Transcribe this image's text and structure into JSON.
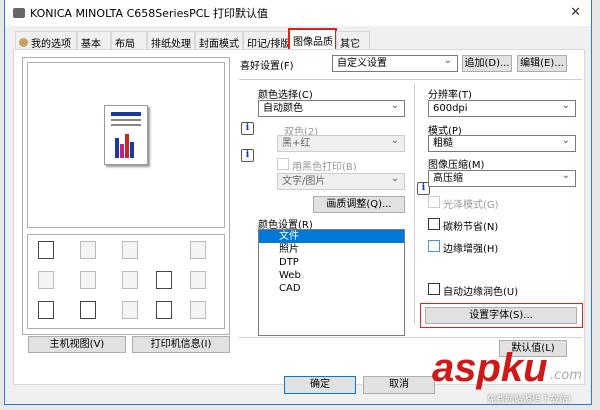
{
  "window": {
    "title": "KONICA MINOLTA C658SeriesPCL 打印默认值",
    "close": "✕"
  },
  "tabs": [
    {
      "label": "我的选项"
    },
    {
      "label": "基本"
    },
    {
      "label": "布局"
    },
    {
      "label": "排纸处理"
    },
    {
      "label": "封面模式"
    },
    {
      "label": "印记/排版"
    },
    {
      "label": "图像品质"
    },
    {
      "label": "其它"
    }
  ],
  "favorites": {
    "label": "喜好设置(F)",
    "value": "自定义设置",
    "add": "追加(D)...",
    "edit": "编辑(E)..."
  },
  "color_select": {
    "label": "颜色选择(C)",
    "value": "自动颜色"
  },
  "two_color": {
    "label": "双色(2)",
    "value": "黑+红"
  },
  "print_black": {
    "label": "用黑色打印(B)",
    "value": "文字/图片"
  },
  "quality_adjust": "画质调整(Q)...",
  "color_settings": {
    "label": "颜色设置(R)",
    "items": [
      "文件",
      "照片",
      "DTP",
      "Web",
      "CAD"
    ],
    "selected": 0
  },
  "resolution": {
    "label": "分辨率(T)",
    "value": "600dpi"
  },
  "mode": {
    "label": "模式(P)",
    "value": "粗糙"
  },
  "compression": {
    "label": "图像压缩(M)",
    "value": "高压缩"
  },
  "checkboxes": {
    "gloss": "光泽模式(G)",
    "toner_save": "碳粉节省(N)",
    "edge_enhance": "边缘增强(H)",
    "auto_trap": "自动边缘润色(U)"
  },
  "set_font": "设置字体(S)...",
  "default": "默认值(L)",
  "host_view": "主机视图(V)",
  "printer_info": "打印机信息(I)",
  "ok": "确定",
  "cancel": "取消",
  "watermark": {
    "logo": "aspku",
    "suffix": ".com",
    "sub": "免费网站源码下载站!"
  },
  "colors": {
    "accent": "#0078d7",
    "highlight": "#e02020"
  }
}
